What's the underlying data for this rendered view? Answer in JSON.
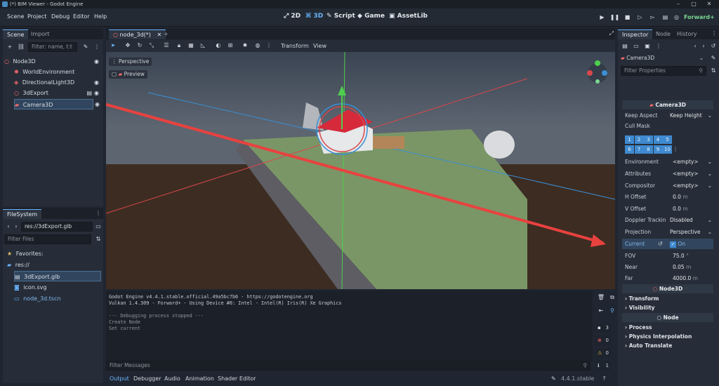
{
  "window": {
    "title": "(*) BIM Viewer - Godot Engine"
  },
  "menu": {
    "items": [
      "Scene",
      "Project",
      "Debug",
      "Editor",
      "Help"
    ]
  },
  "modes": [
    {
      "label": "2D",
      "active": false
    },
    {
      "label": "3D",
      "active": true
    },
    {
      "label": "Script",
      "active": false
    },
    {
      "label": "Game",
      "active": false
    },
    {
      "label": "AssetLib",
      "active": false
    }
  ],
  "renderer": "Forward+",
  "scene_panel": {
    "tabs": [
      "Scene",
      "Import"
    ],
    "filter_placeholder": "Filter: name, t:t",
    "nodes": [
      {
        "name": "Node3D",
        "indent": 0,
        "color": "#ff6b6b"
      },
      {
        "name": "WorldEnvironment",
        "indent": 1,
        "color": "#ff6b6b"
      },
      {
        "name": "DirectionalLight3D",
        "indent": 1,
        "color": "#ff6b6b"
      },
      {
        "name": "3dExport",
        "indent": 1,
        "color": "#ff6b6b"
      },
      {
        "name": "Camera3D",
        "indent": 1,
        "color": "#ff6b6b",
        "selected": true
      }
    ]
  },
  "filesystem": {
    "tab": "FileSystem",
    "path": "res://3dExport.glb",
    "filter_placeholder": "Filter Files",
    "favorites_label": "Favorites:",
    "root_label": "res://",
    "files": [
      {
        "name": "3dExport.glb",
        "selected": true
      },
      {
        "name": "icon.svg",
        "selected": false
      },
      {
        "name": "node_3d.tscn",
        "selected": false
      }
    ]
  },
  "editor_tab": {
    "label": "node_3d(*)"
  },
  "viewport_toolbar": {
    "transform_label": "Transform",
    "view_label": "View"
  },
  "viewport": {
    "perspective_label": "Perspective",
    "preview_label": "Preview"
  },
  "inspector": {
    "tabs": [
      "Inspector",
      "Node",
      "History"
    ],
    "object": "Camera3D",
    "filter_placeholder": "Filter Properties",
    "class_header": "Camera3D",
    "keep_aspect": {
      "label": "Keep Aspect",
      "value": "Keep Height"
    },
    "cull_mask_label": "Cull Mask",
    "layers": [
      "1",
      "2",
      "3",
      "4",
      "5",
      "6",
      "7",
      "8",
      "9",
      "10"
    ],
    "environment": {
      "label": "Environment",
      "value": "<empty>"
    },
    "attributes": {
      "label": "Attributes",
      "value": "<empty>"
    },
    "compositor": {
      "label": "Compositor",
      "value": "<empty>"
    },
    "h_offset": {
      "label": "H Offset",
      "value": "0.0",
      "unit": "m"
    },
    "v_offset": {
      "label": "V Offset",
      "value": "0.0",
      "unit": "m"
    },
    "doppler": {
      "label": "Doppler Trackin",
      "value": "Disabled"
    },
    "projection": {
      "label": "Projection",
      "value": "Perspective"
    },
    "current": {
      "label": "Current",
      "value": "On"
    },
    "fov": {
      "label": "FOV",
      "value": "75.0",
      "unit": "°"
    },
    "near": {
      "label": "Near",
      "value": "0.05",
      "unit": "m"
    },
    "far": {
      "label": "Far",
      "value": "4000.0",
      "unit": "m"
    },
    "node3d_header": "Node3D",
    "transform_group": "Transform",
    "visibility_group": "Visibility",
    "node_header": "Node",
    "process_group": "Process",
    "physics_group": "Physics Interpolation",
    "auto_translate_group": "Auto Translate"
  },
  "output": {
    "lines": [
      "Godot Engine v4.4.1.stable.official.49a5bc7b6 - https://godotengine.org",
      "Vulkan 1.4.309 - Forward+ - Using Device #0: Intel - Intel(R) Iris(R) Xe Graphics",
      "",
      "--- Debugging process stopped ---",
      "Create Node",
      "Set current"
    ],
    "filter_placeholder": "Filter Messages",
    "counts": {
      "messages": "3",
      "errors": "0",
      "warnings": "0",
      "info": "1"
    }
  },
  "bottom_tabs": [
    "Output",
    "Debugger",
    "Audio",
    "Animation",
    "Shader Editor"
  ],
  "version": "4.4.1.stable",
  "colors": {
    "accent": "#6ab4ff",
    "selection": "#31465e",
    "arrow": "#e8423f"
  }
}
